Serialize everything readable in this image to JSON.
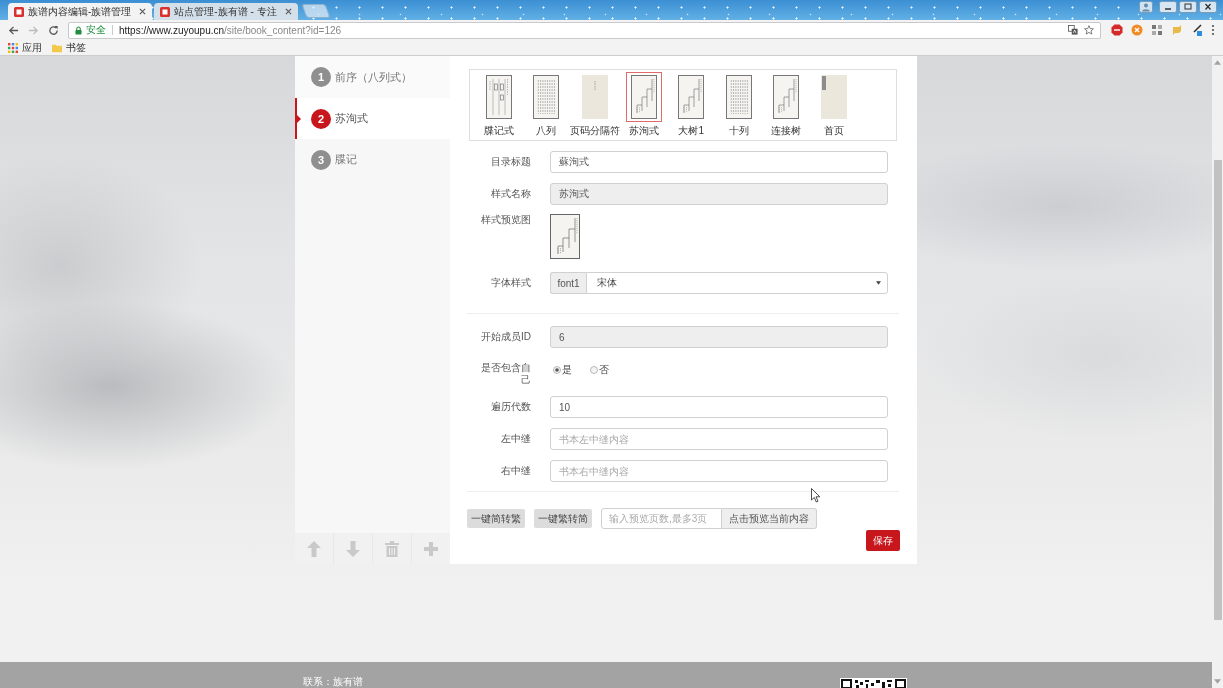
{
  "browser": {
    "tabs": [
      {
        "title": "族谱内容编辑-族谱管理",
        "selected": true
      },
      {
        "title": "站点管理-族有谱 - 专注",
        "selected": false
      }
    ],
    "address_bar": {
      "security": "安全",
      "url_host": "https://www.zuyoupu.cn",
      "url_path": "/site/book_content?id=126"
    },
    "bookmarks": [
      {
        "kind": "apps",
        "label": "应用"
      },
      {
        "kind": "folder",
        "label": "书签"
      }
    ]
  },
  "sidebar": {
    "steps": [
      {
        "number": "1",
        "label": "前序（八列式）",
        "selected": false
      },
      {
        "number": "2",
        "label": "苏洵式",
        "selected": true
      },
      {
        "number": "3",
        "label": "牒记",
        "selected": false
      }
    ]
  },
  "styles": [
    {
      "label": "牒记式",
      "kind": "columns",
      "selected": false
    },
    {
      "label": "八列",
      "kind": "text",
      "selected": false
    },
    {
      "label": "页码分隔符",
      "kind": "plain",
      "selected": false
    },
    {
      "label": "苏洵式",
      "kind": "tree",
      "selected": true
    },
    {
      "label": "大树1",
      "kind": "tree",
      "selected": false
    },
    {
      "label": "十列",
      "kind": "text",
      "selected": false
    },
    {
      "label": "连接树",
      "kind": "tree",
      "selected": false
    },
    {
      "label": "首页",
      "kind": "cover",
      "selected": false
    }
  ],
  "form": {
    "sections": [
      {
        "fields": [
          {
            "kind": "text",
            "label": "目录标题",
            "value": "蘇洵式"
          },
          {
            "kind": "disabled",
            "label": "样式名称",
            "value": "苏洵式"
          },
          {
            "kind": "preview",
            "label": "样式预览图"
          },
          {
            "kind": "select",
            "label": "字体样式",
            "addon": "font1",
            "value": "宋体"
          }
        ]
      },
      {
        "fields": [
          {
            "kind": "disabled",
            "label": "开始成员ID",
            "value": "6"
          },
          {
            "kind": "radio",
            "label": "是否包含自己",
            "options": [
              {
                "label": "是",
                "selected": true
              },
              {
                "label": "否",
                "selected": false
              }
            ]
          },
          {
            "kind": "text",
            "label": "遍历代数",
            "value": "10"
          },
          {
            "kind": "text",
            "label": "左中缝",
            "placeholder": "书本左中缝内容"
          },
          {
            "kind": "text",
            "label": "右中缝",
            "placeholder": "书本右中缝内容"
          }
        ]
      }
    ]
  },
  "actions": {
    "buttons": [
      "一键简转繁",
      "一键繁转简"
    ],
    "preview": {
      "placeholder": "输入预览页数,最多3页",
      "button": "点击预览当前内容"
    },
    "save": "保存"
  },
  "footer": {
    "contact": "联系：族有谱"
  }
}
